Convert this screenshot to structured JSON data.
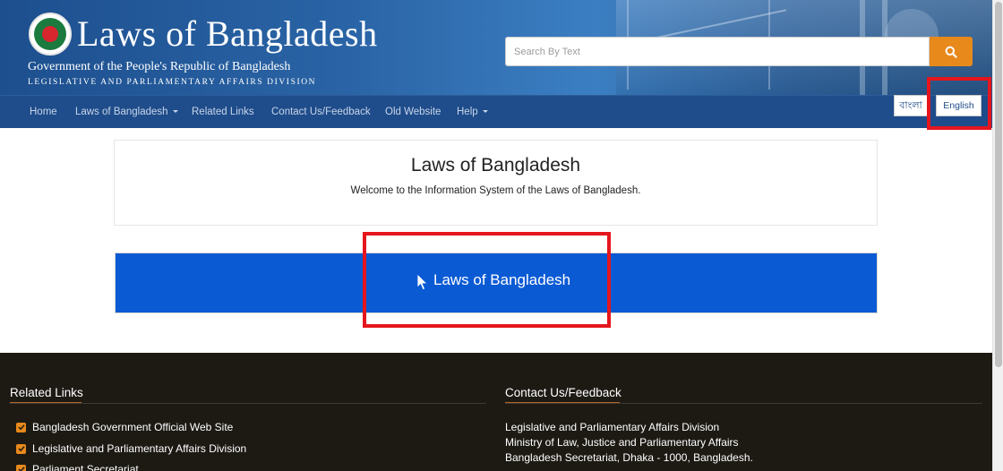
{
  "header": {
    "title": "Laws of Bangladesh",
    "subtitle": "Government of the People's Republic of Bangladesh",
    "division": "LEGISLATIVE AND PARLIAMENTARY AFFAIRS DIVISION",
    "logo_icon": "bangladesh-emblem-icon"
  },
  "search": {
    "placeholder": "Search By Text",
    "button_icon": "search-icon",
    "button_color": "#e8891c"
  },
  "nav": {
    "items": [
      {
        "label": "Home"
      },
      {
        "label": "Laws of Bangladesh",
        "dropdown": true
      },
      {
        "label": "Related Links"
      },
      {
        "label": "Contact Us/Feedback"
      },
      {
        "label": "Old Website"
      },
      {
        "label": "Help",
        "dropdown": true
      }
    ],
    "lang_bangla": "বাংলা",
    "lang_english": "English"
  },
  "main": {
    "welcome_title": "Laws of Bangladesh",
    "welcome_text": "Welcome to the Information System of the Laws of Bangladesh.",
    "primary_button": "Laws of Bangladesh",
    "primary_button_color": "#0a5ad4"
  },
  "footer": {
    "related_heading": "Related Links",
    "related_links": [
      "Bangladesh Government Official Web Site",
      "Legislative and Parliamentary Affairs Division",
      "Parliament Secretariat"
    ],
    "contact_heading": "Contact Us/Feedback",
    "contact_lines": [
      "Legislative and Parliamentary Affairs Division",
      "Ministry of Law, Justice and Parliamentary Affairs",
      "Bangladesh Secretariat, Dhaka - 1000, Bangladesh."
    ],
    "accent_color": "#e8891c"
  },
  "annotations": {
    "highlight_color": "#e5161d"
  }
}
